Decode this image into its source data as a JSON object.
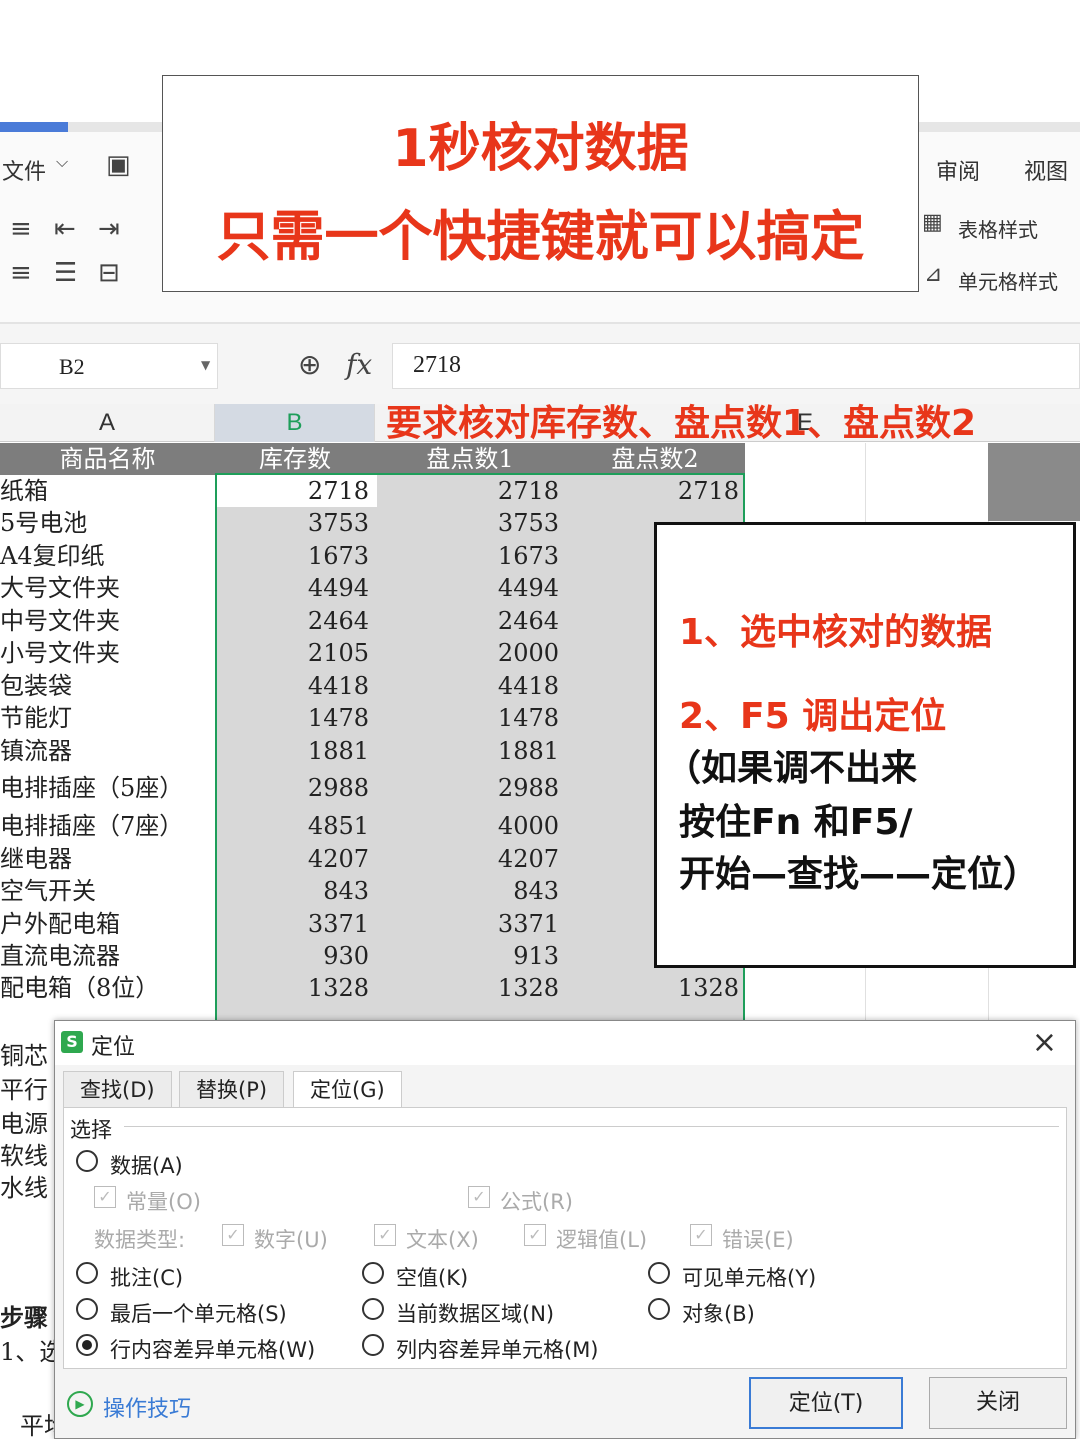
{
  "title_box": {
    "line1": "1秒核对数据",
    "line2": "只需一个快捷键就可以搞定"
  },
  "ribbon": {
    "file_menu": "文件",
    "review_tab": "审阅",
    "view_tab": "视图",
    "table_style": "表格样式",
    "cell_style": "单元格样式"
  },
  "formula_bar": {
    "cell_ref": "B2",
    "fx": "fx",
    "value": "2718"
  },
  "columns": {
    "a": "A",
    "b": "B",
    "e": "E"
  },
  "requirement_note": "要求核对库存数、盘点数1、盘点数2",
  "table": {
    "headers": [
      "商品名称",
      "库存数",
      "盘点数1",
      "盘点数2"
    ],
    "rows": [
      [
        "纸箱",
        "2718",
        "2718",
        "2718"
      ],
      [
        "5号电池",
        "3753",
        "3753",
        ""
      ],
      [
        "A4复印纸",
        "1673",
        "1673",
        ""
      ],
      [
        "大号文件夹",
        "4494",
        "4494",
        ""
      ],
      [
        "中号文件夹",
        "2464",
        "2464",
        ""
      ],
      [
        "小号文件夹",
        "2105",
        "2000",
        ""
      ],
      [
        "包装袋",
        "4418",
        "4418",
        ""
      ],
      [
        "节能灯",
        "1478",
        "1478",
        ""
      ],
      [
        "镇流器",
        "1881",
        "1881",
        ""
      ],
      [
        "电排插座（5座）",
        "2988",
        "2988",
        ""
      ],
      [
        "电排插座（7座）",
        "4851",
        "4000",
        ""
      ],
      [
        "继电器",
        "4207",
        "4207",
        ""
      ],
      [
        "空气开关",
        "843",
        "843",
        ""
      ],
      [
        "户外配电箱",
        "3371",
        "3371",
        ""
      ],
      [
        "直流电流器",
        "930",
        "913",
        ""
      ],
      [
        "配电箱（8位）",
        "1328",
        "1328",
        "1328"
      ]
    ]
  },
  "steps": {
    "step1": "1、选中核对的数据",
    "step2": "2、F5 调出定位",
    "note1": "（如果调不出来",
    "note2": "按住Fn 和F5/",
    "note3": "开始—查找——定位）"
  },
  "behind_dialog": [
    "铜芯",
    "平行",
    "电源",
    "软线",
    "水线",
    "步骤",
    "1、选",
    "平均"
  ],
  "dialog": {
    "logo": "S",
    "title": "定位",
    "close": "×",
    "tabs": [
      "查找(D)",
      "替换(P)",
      "定位(G)"
    ],
    "group_label": "选择",
    "option_data": "数据(A)",
    "sub_constant": "常量(O)",
    "sub_formula": "公式(R)",
    "data_type_label": "数据类型:",
    "type_number": "数字(U)",
    "type_text": "文本(X)",
    "type_logical": "逻辑值(L)",
    "type_error": "错误(E)",
    "options": [
      "批注(C)",
      "空值(K)",
      "可见单元格(Y)",
      "最后一个单元格(S)",
      "当前数据区域(N)",
      "对象(B)",
      "行内容差异单元格(W)",
      "列内容差异单元格(M)"
    ],
    "selected_option": "行内容差异单元格(W)",
    "tips": "操作技巧",
    "btn_locate": "定位(T)",
    "btn_close": "关闭"
  },
  "colors": {
    "accent_red": "#e8361a",
    "selection_green": "#1e9e5a",
    "wps_green": "#2fa84f",
    "link_blue": "#3a7bd5"
  }
}
